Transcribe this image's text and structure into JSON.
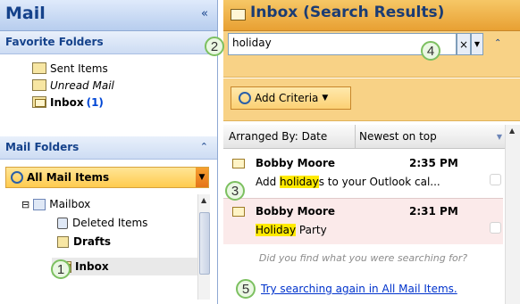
{
  "left": {
    "title": "Mail",
    "collapse_glyph": "«",
    "favorites": {
      "header": "Favorite Folders",
      "expand_glyph": "",
      "items": [
        {
          "label": "Sent Items",
          "count": "",
          "icon": "sent-folder-icon",
          "style": "normal"
        },
        {
          "label": "Unread Mail",
          "count": "",
          "icon": "search-folder-icon",
          "style": "italic"
        },
        {
          "label": "Inbox",
          "count": "(1)",
          "icon": "inbox-folder-icon",
          "style": "bold"
        }
      ]
    },
    "mail_folders": {
      "header": "Mail Folders",
      "expand_glyph": "⌃",
      "all_items_label": "All Mail Items",
      "tree": [
        {
          "label": "Mailbox",
          "level": 0,
          "expander": "⊟"
        },
        {
          "label": "Deleted Items",
          "level": 1
        },
        {
          "label": "Drafts",
          "level": 1
        },
        {
          "label": "Inbox",
          "level": 1
        }
      ]
    }
  },
  "right": {
    "title": "Inbox (Search Results)",
    "search": {
      "value": "holiday",
      "clear_glyph": "×",
      "dropdown_glyph": "▼",
      "expand_glyph": "⌃"
    },
    "add_criteria_label": "Add Criteria",
    "arranged_by": "Arranged By: Date",
    "sort_order": "Newest on top",
    "messages": [
      {
        "from": "Bobby Moore",
        "time": "2:35 PM",
        "subject_pre": "Add ",
        "subject_hl": "holiday",
        "subject_post": "s to your Outlook cal..."
      },
      {
        "from": "Bobby Moore",
        "time": "2:31 PM",
        "subject_pre": "",
        "subject_hl": "Holiday",
        "subject_post": " Party"
      }
    ],
    "notice": "Did you find what you were searching for?",
    "try_again_link": "Try searching again in All Mail Items."
  },
  "callouts": [
    "1",
    "2",
    "3",
    "4",
    "5"
  ],
  "colors": {
    "accent_orange": "#f8d286",
    "nav_blue": "#15428b",
    "highlight": "#ffea00",
    "callout_green": "#7cc060"
  }
}
